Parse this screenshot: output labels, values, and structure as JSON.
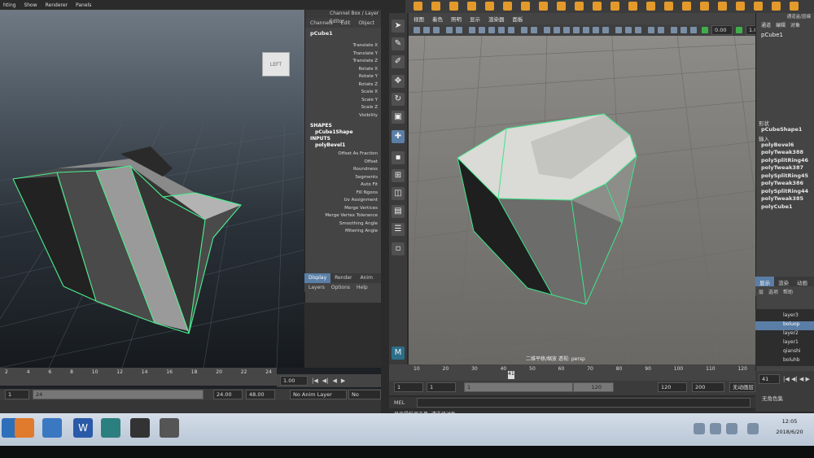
{
  "left": {
    "menu": [
      "hting",
      "Show",
      "Renderer",
      "Panels"
    ],
    "view_cube": "LEFT",
    "channel_box": {
      "header": "Channel Box / Layer Editor",
      "tabs": [
        "Channels",
        "Edit",
        "Object",
        "S"
      ],
      "object": "pCube1",
      "attrs": [
        "Translate X",
        "Translate Y",
        "Translate Z",
        "Rotate X",
        "Rotate Y",
        "Rotate Z",
        "Scale X",
        "Scale Y",
        "Scale Z",
        "Visibility"
      ],
      "shapes_label": "SHAPES",
      "shape": "pCube1Shape",
      "inputs_label": "INPUTS",
      "input": "polyBevel1",
      "bevel_attrs": [
        "Offset As Fraction",
        "Offset",
        "Roundness",
        "Segments",
        "Auto Fit",
        "Fill Ngons",
        "Uv Assignment",
        "Merge Vertices",
        "Merge Vertex Tolerance",
        "Smoothing Angle",
        "Mitering Angle"
      ]
    },
    "layer_tabs": [
      "Display",
      "Render",
      "Anim"
    ],
    "layer_menu": [
      "Layers",
      "Options",
      "Help"
    ],
    "ticks": [
      "2",
      "4",
      "6",
      "8",
      "10",
      "12",
      "14",
      "16",
      "18",
      "20",
      "22",
      "24"
    ],
    "current_frame": "1.00",
    "range_start": "1",
    "range_mid": "24",
    "range_end_a": "24.00",
    "range_end_b": "48.00",
    "anim_layer": "No Anim Layer",
    "character": "No Characte"
  },
  "right": {
    "menu": [
      "视图",
      "着色",
      "照明",
      "显示",
      "渲染器",
      "面板"
    ],
    "exposure": "0.00",
    "gamma": "1.0",
    "cam_label": "二维平移/缩放 透视: persp",
    "ticks": [
      "10",
      "20",
      "30",
      "40",
      "50",
      "60",
      "70",
      "80",
      "90",
      "100",
      "110",
      "120"
    ],
    "current_frame": "41",
    "range_start": "1",
    "range_start2": "1",
    "range_slider_start": "1",
    "range_slider_end": "120",
    "range_end": "120",
    "range_end2": "200",
    "anim_layer": "无动画层",
    "character": "无角色集",
    "end_frame": "41",
    "mel": "MEL",
    "status": "显示操纵器工具: 请选择对象。",
    "panel": {
      "header": "通道盒/层编",
      "tabs": [
        "通道",
        "编辑",
        "对象"
      ],
      "object": "pCube1",
      "shapes_label": "形状",
      "shape": "pCubeShape1",
      "inputs_label": "输入",
      "inputs": [
        "polyBevel6",
        "polyTweak388",
        "polySplitRing46",
        "polyTweak387",
        "polySplitRing45",
        "polyTweak386",
        "polySplitRing44",
        "polyTweak385",
        "polyCube1"
      ],
      "layer_tabs": [
        "显示",
        "渲染",
        "动画"
      ],
      "layer_menu": [
        "层",
        "选项",
        "帮助"
      ],
      "layers": [
        "layer3",
        "boluop",
        "layer2",
        "layer1",
        "qianshi",
        "boluhb"
      ]
    }
  },
  "taskbar": {
    "time": "12:05",
    "date": "2018/6/20"
  }
}
